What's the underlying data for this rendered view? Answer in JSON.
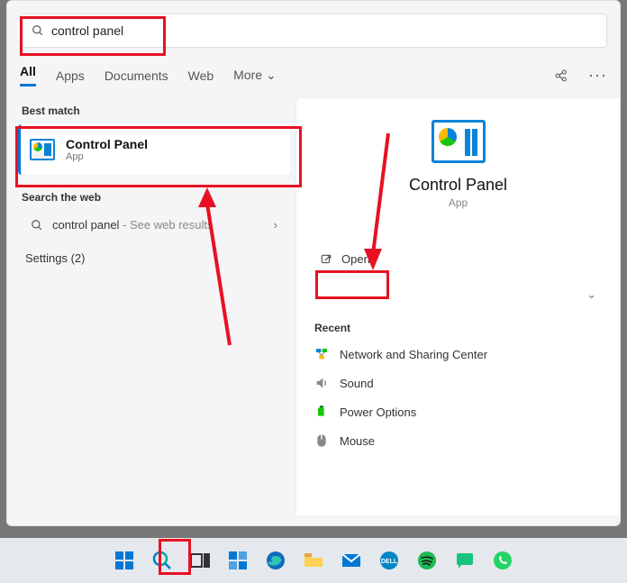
{
  "search": {
    "value": "control panel"
  },
  "tabs": {
    "all": "All",
    "apps": "Apps",
    "documents": "Documents",
    "web": "Web",
    "more": "More"
  },
  "left": {
    "best_label": "Best match",
    "best_title": "Control Panel",
    "best_sub": "App",
    "web_label": "Search the web",
    "web_query": "control panel",
    "web_sub": " - See web results",
    "settings": "Settings (2)"
  },
  "right": {
    "title": "Control Panel",
    "sub": "App",
    "open": "Open",
    "recent_label": "Recent",
    "recent": [
      "Network and Sharing Center",
      "Sound",
      "Power Options",
      "Mouse"
    ]
  },
  "annotation_color": "#e81123"
}
